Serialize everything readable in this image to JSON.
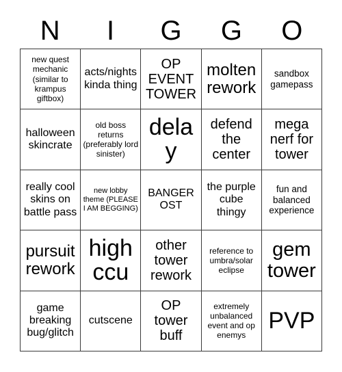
{
  "card": {
    "header_letters": [
      "N",
      "I",
      "G",
      "G",
      "O"
    ],
    "columns": 5,
    "rows": 5,
    "border_color": "#3a3a3a",
    "background_color": "#ffffff",
    "text_color": "#000000",
    "cells": [
      {
        "text": "new quest mechanic (similar to krampus giftbox)",
        "size": "fs-xs"
      },
      {
        "text": "acts/nights kinda thing",
        "size": "fs-m"
      },
      {
        "text": "OP EVENT TOWER",
        "size": "fs-l"
      },
      {
        "text": "molten rework",
        "size": "fs-xl"
      },
      {
        "text": "sandbox gamepass",
        "size": "fs-s"
      },
      {
        "text": "halloween skincrate",
        "size": "fs-m"
      },
      {
        "text": "old boss returns (preferably lord sinister)",
        "size": "fs-xs"
      },
      {
        "text": "delay",
        "size": "fs-3xl"
      },
      {
        "text": "defend the center",
        "size": "fs-l"
      },
      {
        "text": "mega nerf for tower",
        "size": "fs-l"
      },
      {
        "text": "really cool skins on battle pass",
        "size": "fs-m"
      },
      {
        "text": "new lobby theme (PLEASE I AM BEGGING)",
        "size": "fs-xxs"
      },
      {
        "text": "BANGER OST",
        "size": "fs-m"
      },
      {
        "text": "the purple cube thingy",
        "size": "fs-m"
      },
      {
        "text": "fun and balanced experience",
        "size": "fs-s"
      },
      {
        "text": "pursuit rework",
        "size": "fs-xl"
      },
      {
        "text": "high ccu",
        "size": "fs-3xl"
      },
      {
        "text": "other tower rework",
        "size": "fs-l"
      },
      {
        "text": "reference to umbra/solar eclipse",
        "size": "fs-xs"
      },
      {
        "text": "gem tower",
        "size": "fs-2xl"
      },
      {
        "text": "game breaking bug/glitch",
        "size": "fs-m"
      },
      {
        "text": "cutscene",
        "size": "fs-m"
      },
      {
        "text": "OP tower buff",
        "size": "fs-l"
      },
      {
        "text": "extremely unbalanced event and op enemys",
        "size": "fs-xs"
      },
      {
        "text": "PVP",
        "size": "fs-3xl"
      }
    ]
  }
}
